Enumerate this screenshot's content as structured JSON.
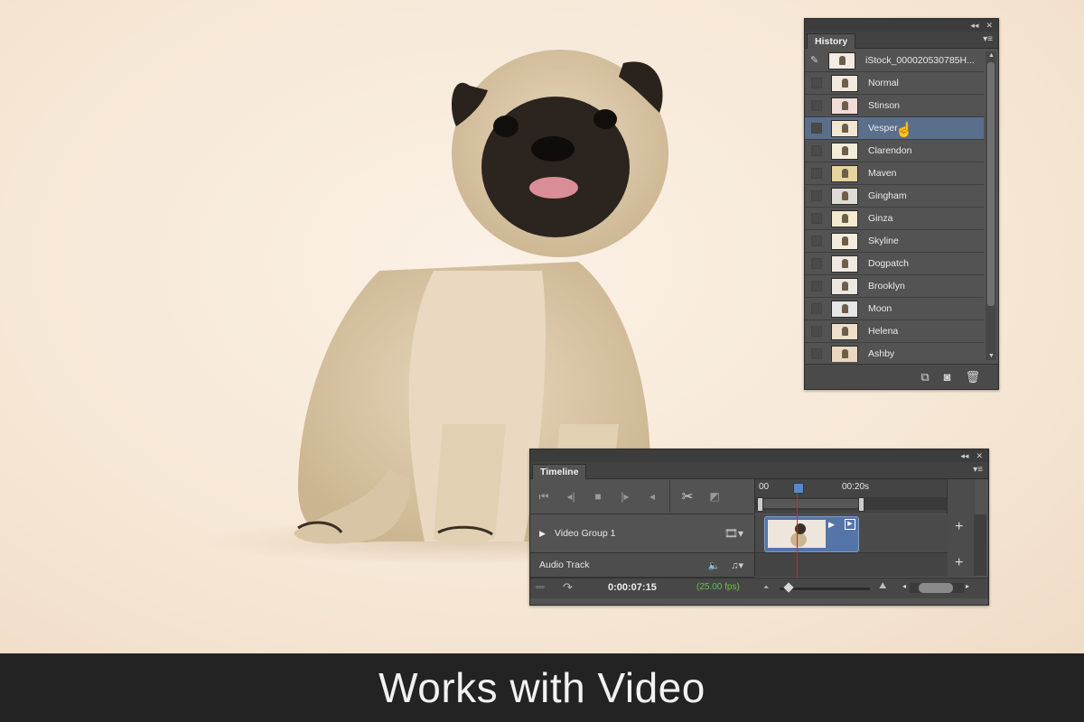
{
  "caption": {
    "text": "Works with Video"
  },
  "panel_icons": {
    "collapse": "◂◂",
    "close": "✕",
    "menu": "▾≡"
  },
  "history": {
    "tab_label": "History",
    "items": [
      {
        "label": "iStock_000020530785H...",
        "thumb_color": "#f3ebe3",
        "snapshot": true
      },
      {
        "label": "Normal",
        "thumb_color": "#f1e8de"
      },
      {
        "label": "Stinson",
        "thumb_color": "#efdcd6"
      },
      {
        "label": "Vesper",
        "thumb_color": "#f3e7d3",
        "selected": true
      },
      {
        "label": "Clarendon",
        "thumb_color": "#f2ecd8"
      },
      {
        "label": "Maven",
        "thumb_color": "#e6d39d"
      },
      {
        "label": "Gingham",
        "thumb_color": "#dedad5"
      },
      {
        "label": "Ginza",
        "thumb_color": "#f4ead0"
      },
      {
        "label": "Skyline",
        "thumb_color": "#f3ecdd"
      },
      {
        "label": "Dogpatch",
        "thumb_color": "#f0e9e2"
      },
      {
        "label": "Brooklyn",
        "thumb_color": "#ece7df"
      },
      {
        "label": "Moon",
        "thumb_color": "#e6e6e6"
      },
      {
        "label": "Helena",
        "thumb_color": "#eedfc8"
      },
      {
        "label": "Ashby",
        "thumb_color": "#ead7c0"
      }
    ],
    "footer_icons": [
      "new-document-from-state-icon",
      "camera-icon",
      "trash-icon"
    ]
  },
  "timeline": {
    "tab_label": "Timeline",
    "ruler_start": "00",
    "ruler_mark": "00:20s",
    "tracks": [
      {
        "label": "Video Group 1",
        "icon": "film-icon"
      },
      {
        "label": "Audio Track",
        "icon": "music-icon"
      }
    ],
    "current_time": "0:00:07:15",
    "fps": "(25.00 fps)",
    "playhead_fraction": 0.22
  }
}
